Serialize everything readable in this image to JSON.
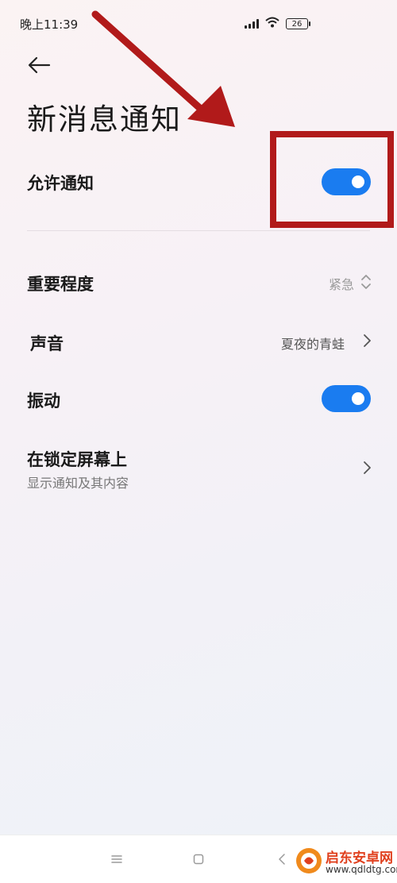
{
  "status_bar": {
    "time": "晚上11:39",
    "battery": "26",
    "icons": [
      "signal-icon",
      "wifi-icon",
      "battery-icon"
    ]
  },
  "header": {
    "back_icon": "arrow-left-icon",
    "title": "新消息通知"
  },
  "settings": {
    "allow_notifications": {
      "label": "允许通知",
      "enabled": true
    },
    "importance": {
      "label": "重要程度",
      "value": "紧急",
      "icon": "up-down-chevron-icon"
    },
    "sound": {
      "label": "声音",
      "value": "夏夜的青蛙",
      "icon": "chevron-right-icon"
    },
    "vibration": {
      "label": "振动",
      "enabled": true
    },
    "lock_screen": {
      "label": "在锁定屏幕上",
      "subtitle": "显示通知及其内容",
      "icon": "chevron-right-icon"
    }
  },
  "colors": {
    "toggle_on": "#1a7cf0",
    "annotation": "#b11a1a",
    "watermark": "#e0401e"
  },
  "nav_bar": {
    "icons": [
      "menu-icon",
      "home-square-icon",
      "back-chevron-icon"
    ]
  },
  "watermark": {
    "title": "启东安卓网",
    "url": "www.qdldtg.com"
  }
}
